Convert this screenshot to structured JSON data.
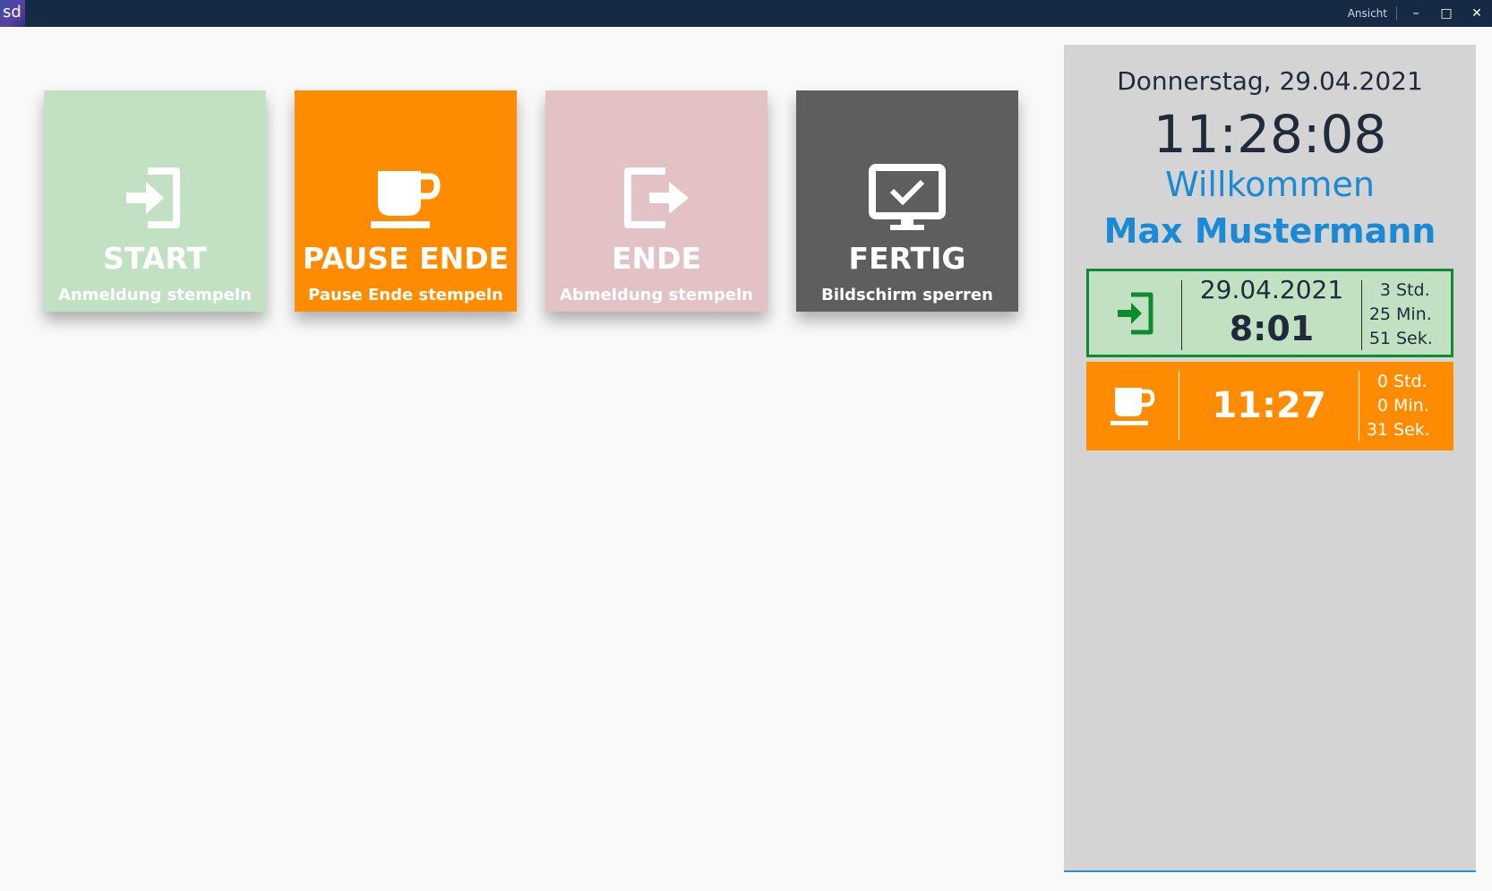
{
  "titlebar": {
    "app_logo": "sd",
    "view_label": "Ansicht",
    "minimize_glyph": "–",
    "maximize_glyph": "□",
    "close_glyph": "✕"
  },
  "tiles": [
    {
      "title": "START",
      "subtitle": "Anmeldung stempeln",
      "icon": "sign-in-icon",
      "color": "#c2e1c3"
    },
    {
      "title": "PAUSE ENDE",
      "subtitle": "Pause Ende stempeln",
      "icon": "coffee-cup-icon",
      "color": "#ff8c00"
    },
    {
      "title": "ENDE",
      "subtitle": "Abmeldung stempeln",
      "icon": "sign-out-icon",
      "color": "#e2c2c5"
    },
    {
      "title": "FERTIG",
      "subtitle": "Bildschirm sperren",
      "icon": "monitor-check-icon",
      "color": "#5e5e5e"
    }
  ],
  "panel": {
    "date": "Donnerstag, 29.04.2021",
    "time": "11:28:08",
    "welcome": "Willkommen",
    "user": "Max Mustermann",
    "login_card": {
      "icon": "sign-in-icon",
      "date": "29.04.2021",
      "time": "8:01",
      "hours": "3",
      "hours_unit": "Std.",
      "minutes": "25",
      "minutes_unit": "Min.",
      "seconds": "51",
      "seconds_unit": "Sek."
    },
    "pause_card": {
      "icon": "coffee-cup-icon",
      "time": "11:27",
      "hours": "0",
      "hours_unit": "Std.",
      "minutes": "0",
      "minutes_unit": "Min.",
      "seconds": "31",
      "seconds_unit": "Sek."
    }
  },
  "colors": {
    "titlebar": "#172a45",
    "accent_blue": "#1a8ad4",
    "login_green": "#0f8a2c",
    "pause_orange": "#ff8c00"
  }
}
